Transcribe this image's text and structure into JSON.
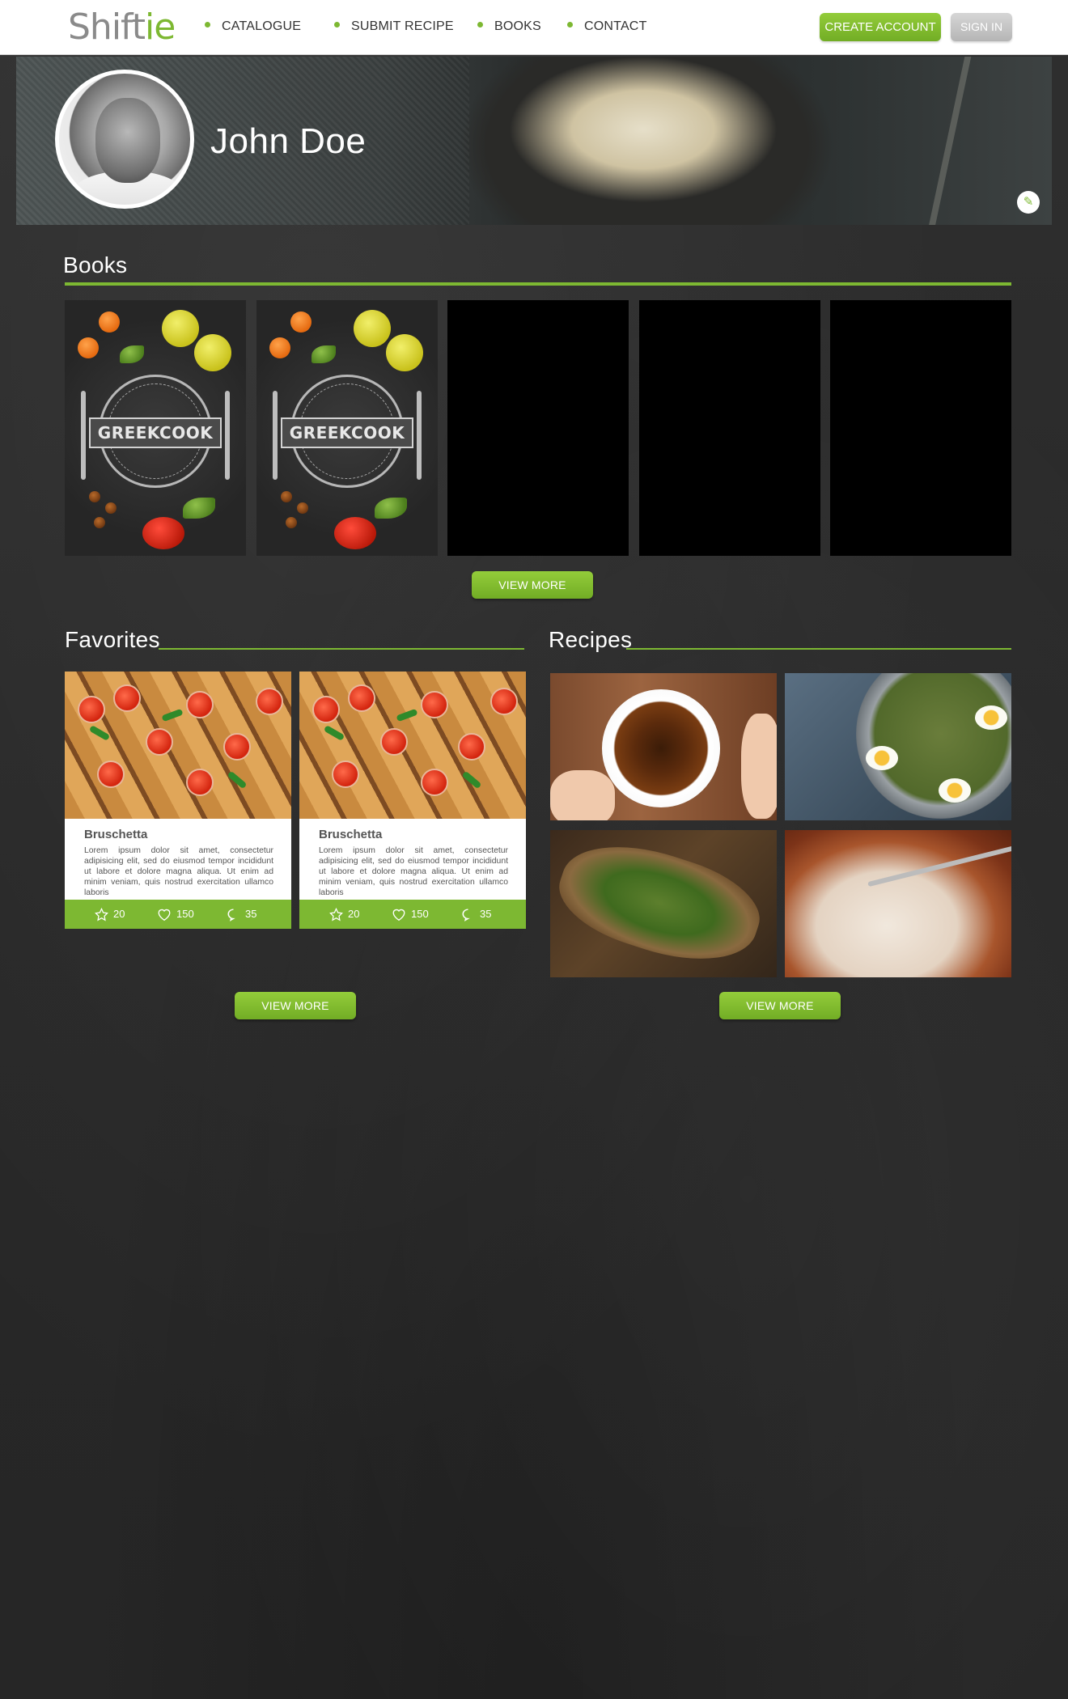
{
  "header": {
    "logo_main": "Shift",
    "logo_accent": "ie",
    "nav": [
      "CATALOGUE",
      "SUBMIT RECIPE",
      "BOOKS",
      "CONTACT"
    ],
    "create_account": "CREATE ACCOUNT",
    "sign_in": "SIGN IN"
  },
  "profile": {
    "name": "John Doe"
  },
  "books": {
    "title": "Books",
    "items": [
      {
        "cover_text": "GREEKCOOK"
      },
      {
        "cover_text": "GREEKCOOK"
      },
      {
        "cover_text": ""
      },
      {
        "cover_text": ""
      },
      {
        "cover_text": ""
      }
    ],
    "view_more": "VIEW MORE"
  },
  "favorites": {
    "title": "Favorites",
    "cards": [
      {
        "title": "Bruschetta",
        "description": "Lorem ipsum dolor sit amet, consectetur adipisicing elit, sed do eiusmod tempor incididunt ut labore et dolore magna aliqua. Ut enim ad minim veniam, quis nostrud exercitation ullamco laboris",
        "stars": "20",
        "likes": "150",
        "comments": "35"
      },
      {
        "title": "Bruschetta",
        "description": "Lorem ipsum dolor sit amet, consectetur adipisicing elit, sed do eiusmod tempor incididunt ut labore et dolore magna aliqua. Ut enim ad minim veniam, quis nostrud exercitation ullamco laboris",
        "stars": "20",
        "likes": "150",
        "comments": "35"
      }
    ],
    "view_more": "VIEW MORE"
  },
  "recipes": {
    "title": "Recipes",
    "view_more": "VIEW MORE"
  },
  "colors": {
    "accent": "#7db832",
    "background": "#2b2b2b",
    "header_bg": "#ffffff",
    "sign_in_bg": "#c4c4c4"
  }
}
